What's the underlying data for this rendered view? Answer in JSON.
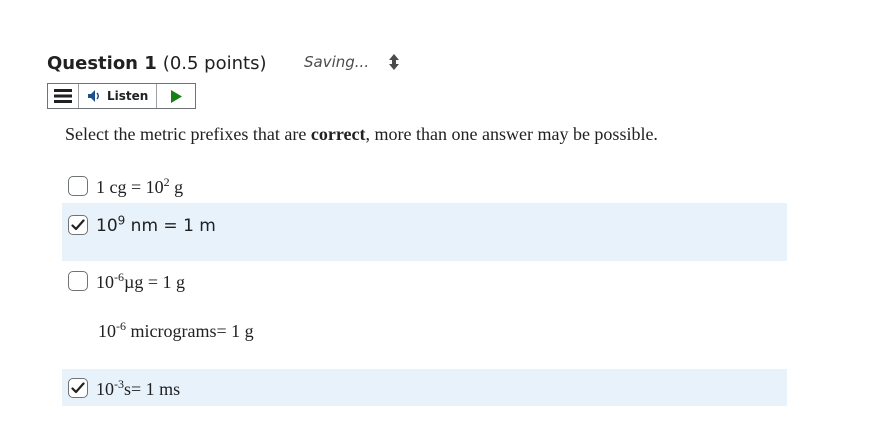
{
  "question": {
    "title": "Question 1",
    "points": "(0.5 points)",
    "status": "Saving..."
  },
  "toolbar": {
    "listen_label": "Listen"
  },
  "prompt": {
    "before": "Select the metric prefixes that are ",
    "bold": "correct",
    "after": ", more than one answer may be possible."
  },
  "options": [
    {
      "base": "1 cg = 10",
      "sup": "2",
      "rest": " g",
      "checked": false
    },
    {
      "base": "10",
      "sup": "9",
      "rest": " nm = 1 m",
      "checked": true
    },
    {
      "base": "10",
      "sup": "-6",
      "rest": "µg = 1 g",
      "checked": false,
      "extra": {
        "base": "10",
        "sup": "-6",
        "rest": " micrograms= 1 g"
      }
    },
    {
      "base": "10",
      "sup": "-3",
      "rest": "s= 1 ms",
      "checked": true
    }
  ],
  "colors": {
    "selected_bg": "#e8f2fb",
    "play_green": "#1a7e16",
    "text": "#202122"
  }
}
